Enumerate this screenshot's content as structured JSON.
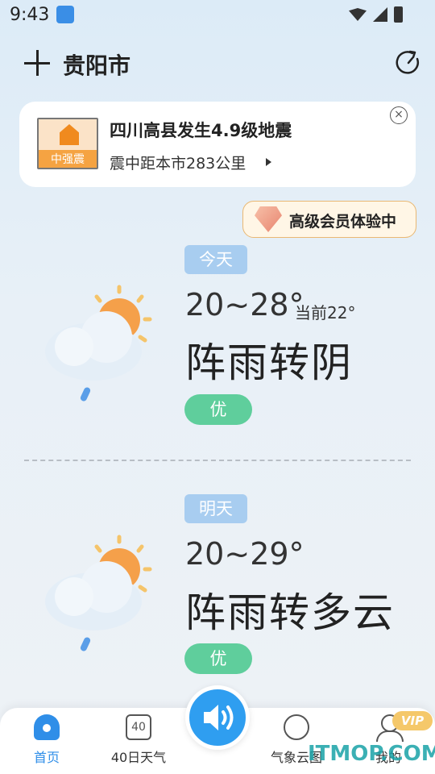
{
  "status_bar": {
    "time": "9:43"
  },
  "header": {
    "city": "贵阳市"
  },
  "alert": {
    "badge_label": "中强震",
    "title": "四川高县发生4.9级地震",
    "subtitle": "震中距本市283公里"
  },
  "vip_trial": {
    "label": "高级会员体验中"
  },
  "days": [
    {
      "tag": "今天",
      "temp_range": "20~28°",
      "current": "当前22°",
      "condition": "阵雨转阴",
      "aqi": "优"
    },
    {
      "tag": "明天",
      "temp_range": "20~29°",
      "condition": "阵雨转多云",
      "aqi": "优"
    }
  ],
  "nav": {
    "items": [
      {
        "label": "首页"
      },
      {
        "label": "40日天气"
      },
      {
        "label": "气象云图"
      },
      {
        "label": "我的"
      }
    ],
    "calendar_number": "40",
    "vip_badge": "VIP"
  },
  "watermark": "ITMOP.COM",
  "colors": {
    "accent": "#2f8ee8",
    "aqi_good": "#5fce9c",
    "day_tag": "#a8cdf0",
    "alert_orange": "#f5a342"
  }
}
